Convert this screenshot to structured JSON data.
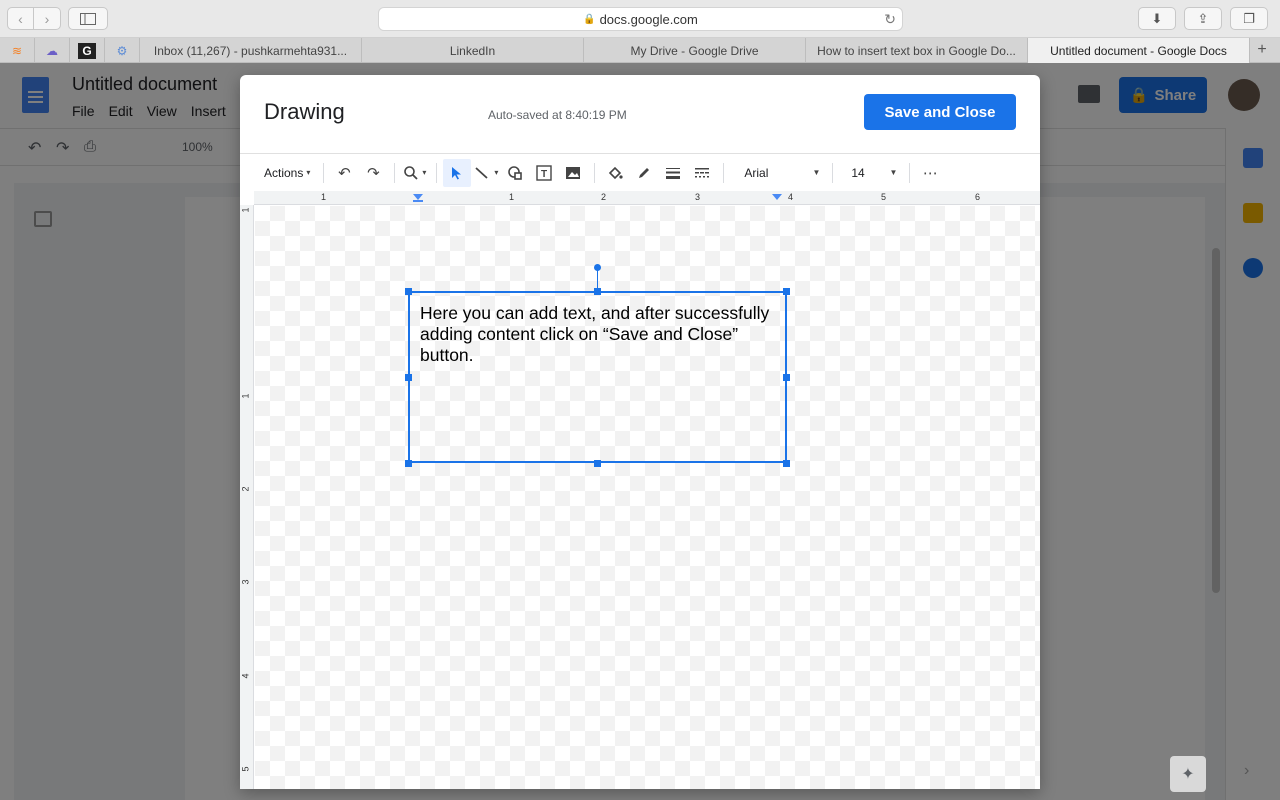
{
  "browser": {
    "url": "docs.google.com",
    "tabs": [
      {
        "label": "Inbox (11,267) - pushkarmehta931..."
      },
      {
        "label": "LinkedIn"
      },
      {
        "label": "My Drive - Google Drive"
      },
      {
        "label": "How to insert text box in Google Do..."
      },
      {
        "label": "Untitled document - Google Docs"
      }
    ],
    "favicon_tab_label": "G"
  },
  "docs": {
    "title": "Untitled document",
    "menu": [
      "File",
      "Edit",
      "View",
      "Insert"
    ],
    "share_label": "Share",
    "zoom": "100%"
  },
  "dialog": {
    "title": "Drawing",
    "autosave": "Auto-saved at 8:40:19 PM",
    "save_label": "Save and Close",
    "toolbar": {
      "actions_label": "Actions",
      "font": "Arial",
      "font_size": "14",
      "more": "⋯"
    },
    "textbox_text": "Here you can add text, and after successfully adding content click on “Save and Close” button.",
    "ruler_labels": [
      "1",
      "1",
      "2",
      "3",
      "4",
      "5",
      "6"
    ],
    "vruler_labels": [
      "1",
      "1",
      "2",
      "3",
      "4",
      "5"
    ]
  },
  "colors": {
    "accent": "#1a73e8"
  }
}
